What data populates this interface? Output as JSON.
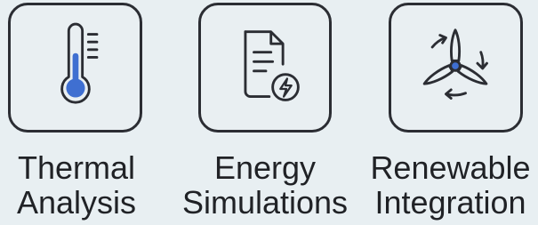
{
  "features": [
    {
      "line1": "Thermal",
      "line2": "Analysis",
      "icon": "thermometer-icon"
    },
    {
      "line1": "Energy",
      "line2": "Simulations",
      "icon": "energy-document-icon"
    },
    {
      "line1": "Renewable",
      "line2": "Integration",
      "icon": "wind-turbine-icon"
    }
  ],
  "colors": {
    "background": "#e8eff2",
    "outline": "#2b2d33",
    "accent": "#3f6fd1"
  }
}
